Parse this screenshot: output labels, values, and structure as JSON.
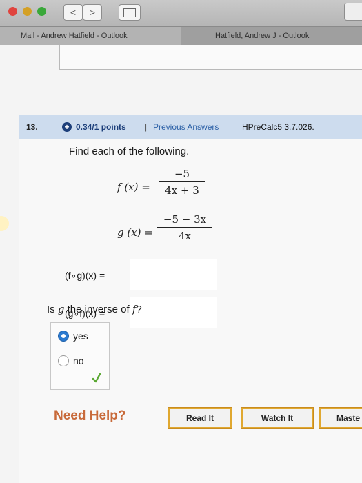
{
  "browser": {
    "back_glyph": "<",
    "forward_glyph": ">",
    "tabs": [
      {
        "label": "Mail - Andrew Hatfield - Outlook"
      },
      {
        "label": "Hatfield, Andrew J - Outlook"
      }
    ]
  },
  "question": {
    "number": "13.",
    "plus": "+",
    "points": "0.34/1 points",
    "separator": "|",
    "previous_answers": "Previous Answers",
    "assignment_id": "HPreCalc5 3.7.026.",
    "prompt": "Find each of the following."
  },
  "functions": {
    "f_lhs": "f (x) =",
    "f_num": "−5",
    "f_den": "4x + 3",
    "g_lhs": "g (x) =",
    "g_num": "−5 − 3x",
    "g_den": "4x"
  },
  "compositions": {
    "fog_label": "(f∘g)(x) =",
    "gof_label": "(g∘f)(x) =",
    "fog_value": "",
    "gof_value": ""
  },
  "inverse_question": {
    "text_prefix": "Is",
    "g": "g",
    "middle": "the inverse of",
    "f": "f",
    "suffix": "?",
    "options": [
      {
        "label": "yes",
        "selected": true
      },
      {
        "label": "no",
        "selected": false
      }
    ],
    "result_icon": "check-icon",
    "check_color": "#5aa832"
  },
  "help": {
    "label": "Need Help?",
    "read": "Read It",
    "watch": "Watch It",
    "master": "Maste"
  }
}
